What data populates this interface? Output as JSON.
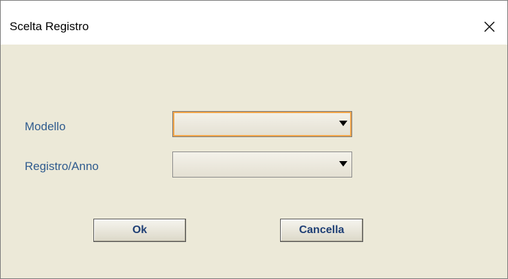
{
  "dialog": {
    "title": "Scelta Registro"
  },
  "fields": {
    "modello_label": "Modello",
    "modello_value": "",
    "registro_label": "Registro/Anno",
    "registro_value": ""
  },
  "buttons": {
    "ok_label": "Ok",
    "cancel_label": "Cancella"
  },
  "colors": {
    "label_text": "#2f5b8e",
    "button_text": "#1f3f75",
    "dialog_background": "#ece9d8",
    "focus_ring": "#f2a64a"
  },
  "icons": {
    "close": "close-icon",
    "dropdown": "dropdown-arrow-icon"
  }
}
